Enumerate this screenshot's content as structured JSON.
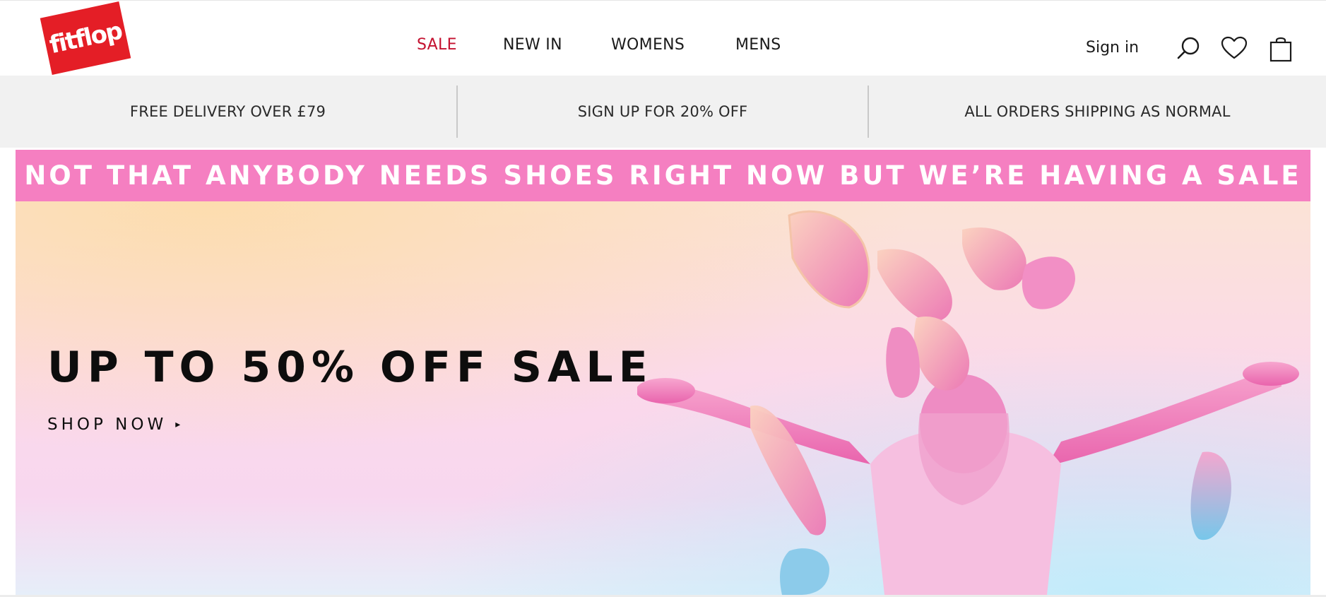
{
  "brand": {
    "logo_text": "fitflop",
    "logo_color": "#e41e26"
  },
  "nav": {
    "items": [
      {
        "label": "SALE",
        "color": "#c41230"
      },
      {
        "label": "NEW IN"
      },
      {
        "label": "WOMENS"
      },
      {
        "label": "MENS"
      }
    ]
  },
  "account": {
    "signin_label": "Sign in",
    "icons": [
      "search-icon",
      "wishlist-heart-icon",
      "shopping-bag-icon"
    ]
  },
  "usp_bar": {
    "items": [
      "FREE DELIVERY OVER £79",
      "SIGN UP FOR 20% OFF",
      "ALL ORDERS SHIPPING AS NORMAL"
    ]
  },
  "promo_strip": {
    "text": "NOT THAT ANYBODY NEEDS SHOES RIGHT NOW BUT WE’RE HAVING A SALE",
    "background": "#f57fc1"
  },
  "hero": {
    "title": "UP TO 50% OFF SALE",
    "cta_label": "SHOP NOW",
    "cta_arrow": "▸"
  }
}
